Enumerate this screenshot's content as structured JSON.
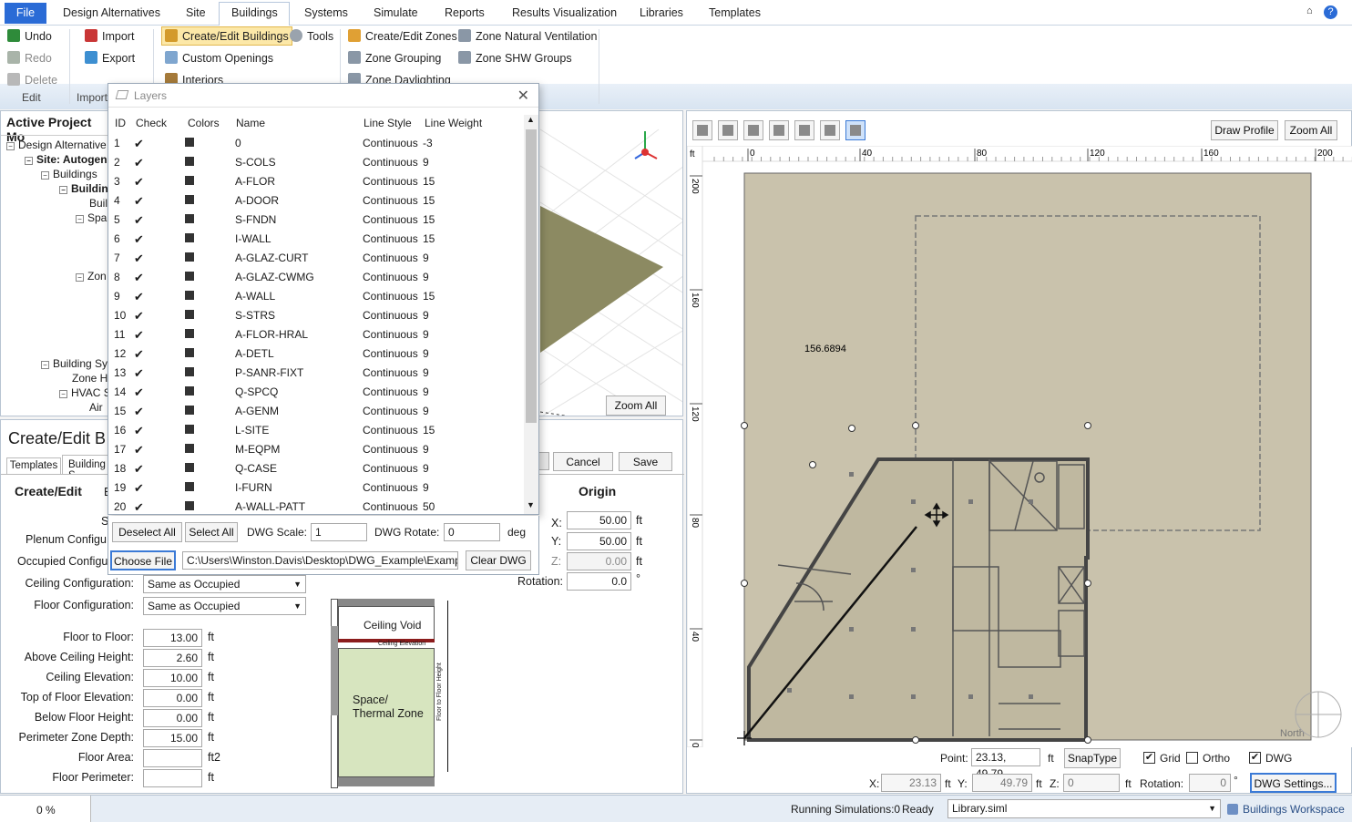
{
  "menu": {
    "file": "File",
    "items": [
      "Design Alternatives",
      "Site",
      "Buildings",
      "Systems",
      "Simulate",
      "Reports",
      "Results Visualization",
      "Libraries",
      "Templates"
    ]
  },
  "ribbon": {
    "undo": "Undo",
    "redo": "Redo",
    "delete": "Delete",
    "edit_group": "Edit",
    "import": "Import",
    "export": "Export",
    "import_group": "Import",
    "create_edit_buildings": "Create/Edit Buildings",
    "tools": "Tools",
    "custom_openings": "Custom Openings",
    "interiors": "Interiors",
    "create_edit_zones": "Create/Edit Zones",
    "zone_natural_ventilation": "Zone Natural Ventilation",
    "zone_grouping": "Zone Grouping",
    "zone_shw_groups": "Zone SHW Groups",
    "zone_daylighting": "Zone Daylighting"
  },
  "project": {
    "title": "Active Project Mo",
    "tree": [
      "Design Alternative",
      "Site: Autogen",
      "Buildings",
      "Buildin",
      "Buil",
      "Spa",
      "Zon",
      "Building Sys",
      "Zone H",
      "HVAC S",
      "Air"
    ]
  },
  "viewport3d": {
    "zoom_all": "Zoom All"
  },
  "layers": {
    "title": "Layers",
    "headers": {
      "id": "ID",
      "check": "Check",
      "colors": "Colors",
      "name": "Name",
      "line_style": "Line Style",
      "line_weight": "Line Weight"
    },
    "rows": [
      {
        "id": "1",
        "name": "0",
        "style": "Continuous",
        "weight": "-3"
      },
      {
        "id": "2",
        "name": "S-COLS",
        "style": "Continuous",
        "weight": "9"
      },
      {
        "id": "3",
        "name": "A-FLOR",
        "style": "Continuous",
        "weight": "15"
      },
      {
        "id": "4",
        "name": "A-DOOR",
        "style": "Continuous",
        "weight": "15"
      },
      {
        "id": "5",
        "name": "S-FNDN",
        "style": "Continuous",
        "weight": "15"
      },
      {
        "id": "6",
        "name": "I-WALL",
        "style": "Continuous",
        "weight": "15"
      },
      {
        "id": "7",
        "name": "A-GLAZ-CURT",
        "style": "Continuous",
        "weight": "9"
      },
      {
        "id": "8",
        "name": "A-GLAZ-CWMG",
        "style": "Continuous",
        "weight": "9"
      },
      {
        "id": "9",
        "name": "A-WALL",
        "style": "Continuous",
        "weight": "15"
      },
      {
        "id": "10",
        "name": "S-STRS",
        "style": "Continuous",
        "weight": "9"
      },
      {
        "id": "11",
        "name": "A-FLOR-HRAL",
        "style": "Continuous",
        "weight": "9"
      },
      {
        "id": "12",
        "name": "A-DETL",
        "style": "Continuous",
        "weight": "9"
      },
      {
        "id": "13",
        "name": "P-SANR-FIXT",
        "style": "Continuous",
        "weight": "9"
      },
      {
        "id": "14",
        "name": "Q-SPCQ",
        "style": "Continuous",
        "weight": "9"
      },
      {
        "id": "15",
        "name": "A-GENM",
        "style": "Continuous",
        "weight": "9"
      },
      {
        "id": "16",
        "name": "L-SITE",
        "style": "Continuous",
        "weight": "15"
      },
      {
        "id": "17",
        "name": "M-EQPM",
        "style": "Continuous",
        "weight": "9"
      },
      {
        "id": "18",
        "name": "Q-CASE",
        "style": "Continuous",
        "weight": "9"
      },
      {
        "id": "19",
        "name": "I-FURN",
        "style": "Continuous",
        "weight": "9"
      },
      {
        "id": "20",
        "name": "A-WALL-PATT",
        "style": "Continuous",
        "weight": "50"
      }
    ],
    "check_mark": "✔",
    "deselect_all": "Deselect All",
    "select_all": "Select All",
    "dwg_scale_label": "DWG Scale:",
    "dwg_scale": "1",
    "dwg_rotate_label": "DWG Rotate:",
    "dwg_rotate": "0",
    "deg": "deg",
    "choose_file": "Choose File",
    "file_path": "C:\\Users\\Winston.Davis\\Desktop\\DWG_Example\\Example_Fl",
    "clear_dwg": "Clear DWG"
  },
  "create_edit": {
    "title": "Create/Edit B",
    "tabs": [
      "Templates",
      "Building S"
    ],
    "subtitle": "Create/Edit",
    "sub_b": "B",
    "s_label": "S",
    "cancel": "Cancel",
    "save": "Save",
    "plenum_label": "Plenum Configu",
    "occupied_label": "Occupied Configu",
    "ceiling_config_label": "Ceiling Configuration:",
    "ceiling_config": "Same as Occupied",
    "floor_config_label": "Floor Configuration:",
    "floor_config": "Same as Occupied",
    "fields": [
      {
        "label": "Floor to Floor:",
        "value": "13.00",
        "unit": "ft"
      },
      {
        "label": "Above Ceiling Height:",
        "value": "2.60",
        "unit": "ft"
      },
      {
        "label": "Ceiling Elevation:",
        "value": "10.00",
        "unit": "ft"
      },
      {
        "label": "Top of Floor Elevation:",
        "value": "0.00",
        "unit": "ft"
      },
      {
        "label": "Below Floor Height:",
        "value": "0.00",
        "unit": "ft"
      },
      {
        "label": "Perimeter Zone Depth:",
        "value": "15.00",
        "unit": "ft"
      },
      {
        "label": "Floor Area:",
        "value": "",
        "unit": "ft2"
      },
      {
        "label": "Floor Perimeter:",
        "value": "",
        "unit": "ft"
      }
    ],
    "origin": {
      "title": "Origin",
      "x_label": "X:",
      "x": "50.00",
      "y_label": "Y:",
      "y": "50.00",
      "z_label": "Z:",
      "z": "0.00",
      "rotation_label": "Rotation:",
      "rotation": "0.0",
      "unit": "ft",
      "deg": "°"
    },
    "diagram": {
      "ceiling_void": "Ceiling Void",
      "ceiling_elevation": "Ceiling Elevation",
      "space_line1": "Space/",
      "space_line2": "Thermal Zone",
      "floor_to_floor": "Floor to Floor Height"
    }
  },
  "drawing": {
    "tool_names": [
      "select-tool",
      "l-shape-tool",
      "h-shape-tool",
      "plus-shape-tool",
      "u-shape-tool",
      "t-shape-tool",
      "draw-tool"
    ],
    "draw_profile": "Draw Profile",
    "zoom_all": "Zoom All",
    "ruler_unit": "ft",
    "x_ticks": [
      "0",
      "40",
      "80",
      "120",
      "160",
      "200"
    ],
    "y_ticks": [
      "200",
      "160",
      "120",
      "80",
      "40",
      "0"
    ],
    "dimension": "156.6894",
    "north": "North",
    "point_label": "Point:",
    "point": "23.13, 49.79",
    "point_unit": "ft",
    "snap_type": "SnapType",
    "grid": "Grid",
    "ortho": "Ortho",
    "dwg": "DWG",
    "grid_checked": true,
    "ortho_checked": false,
    "dwg_checked": true,
    "x_label": "X:",
    "x": "23.13",
    "y_label": "Y:",
    "y": "49.79",
    "z_label": "Z:",
    "z": "0",
    "rotation_label": "Rotation:",
    "rotation": "0",
    "unit": "ft",
    "deg": "°",
    "dwg_settings": "DWG Settings..."
  },
  "status": {
    "progress": "0 %",
    "running": "Running Simulations:0",
    "ready": "Ready",
    "library": "Library.siml",
    "workspace": "Buildings Workspace"
  }
}
